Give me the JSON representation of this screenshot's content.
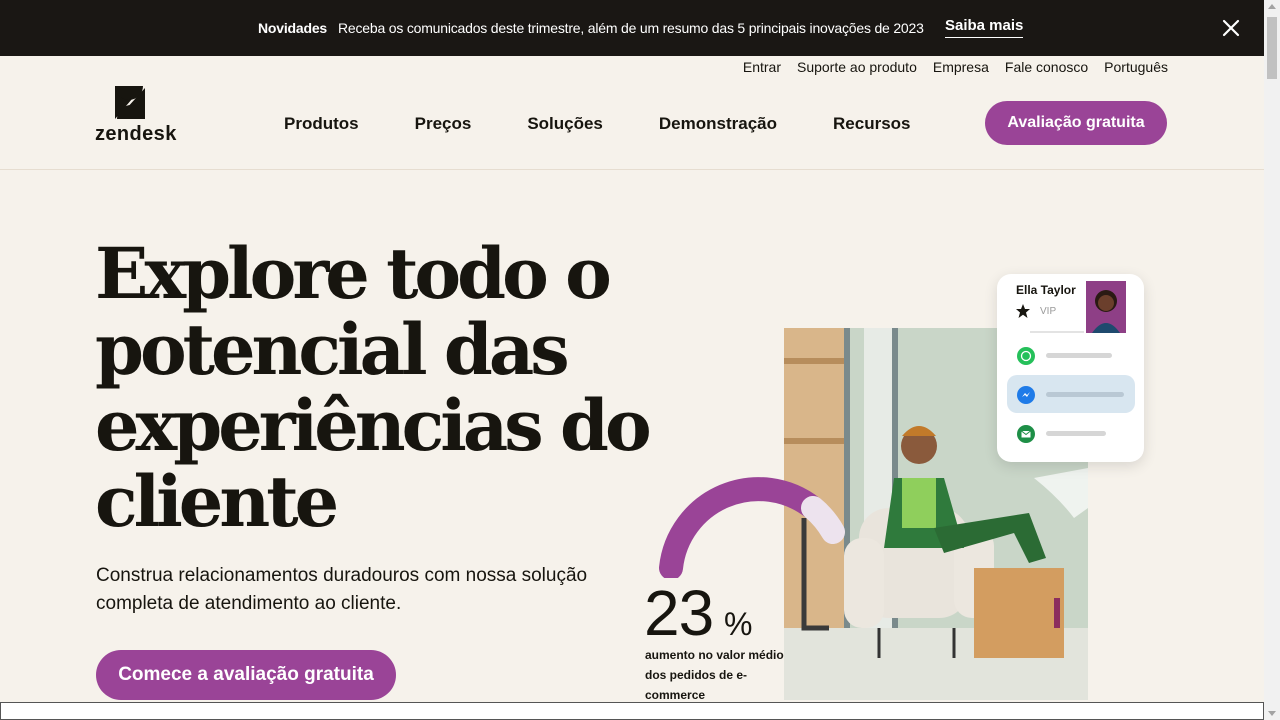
{
  "announcement": {
    "label": "Novidades",
    "text": "Receba os comunicados deste trimestre, além de um resumo das 5 principais inovações de 2023",
    "link": "Saiba mais"
  },
  "utility_nav": [
    "Entrar",
    "Suporte ao produto",
    "Empresa",
    "Fale conosco",
    "Português"
  ],
  "logo": {
    "wordmark": "zendesk"
  },
  "main_nav": [
    "Produtos",
    "Preços",
    "Soluções",
    "Demonstração",
    "Recursos"
  ],
  "header_cta": "Avaliação gratuita",
  "hero": {
    "title": "Explore todo o potencial das experiências do cliente",
    "subtitle": "Construa relacionamentos duradouros com nossa solução completa de atendimento ao cliente.",
    "cta": "Comece a avaliação gratuita"
  },
  "stat": {
    "value": "23",
    "unit": "%",
    "caption": "aumento no valor médio dos pedidos de e-commerce"
  },
  "profile_card": {
    "name": "Ella Taylor",
    "tier": "VIP",
    "channels": [
      "whatsapp-icon",
      "messenger-icon",
      "email-icon"
    ]
  },
  "colors": {
    "brand_purple": "#9a4497",
    "announcement_bg": "#1a1714",
    "page_bg": "#f6f2eb",
    "whatsapp_green": "#25c05a",
    "messenger_blue": "#1f7be8"
  }
}
